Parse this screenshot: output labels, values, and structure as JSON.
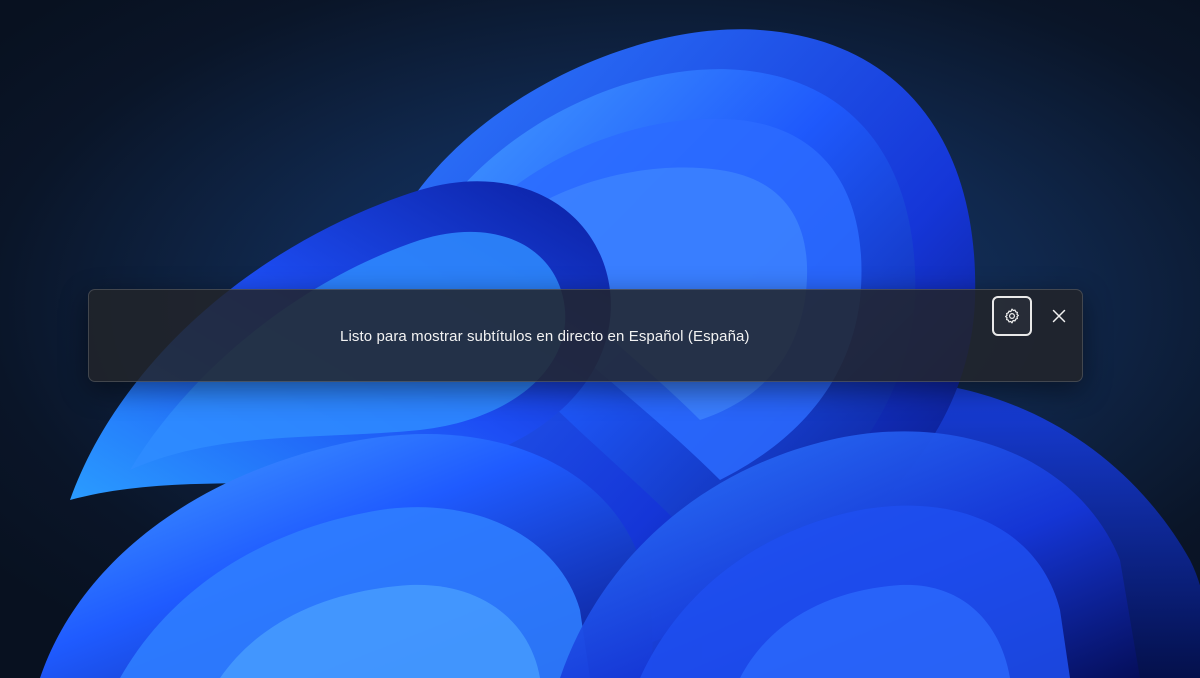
{
  "caption_bar": {
    "message": "Listo para mostrar subtítulos en directo en Español (España)",
    "settings_button": {
      "icon": "gear-icon",
      "tooltip": ""
    },
    "close_button": {
      "icon": "close-icon"
    }
  },
  "wallpaper": {
    "style": "Windows 11 Bloom",
    "background_color": "#0b1526",
    "accent_color": "#1f5bff"
  }
}
